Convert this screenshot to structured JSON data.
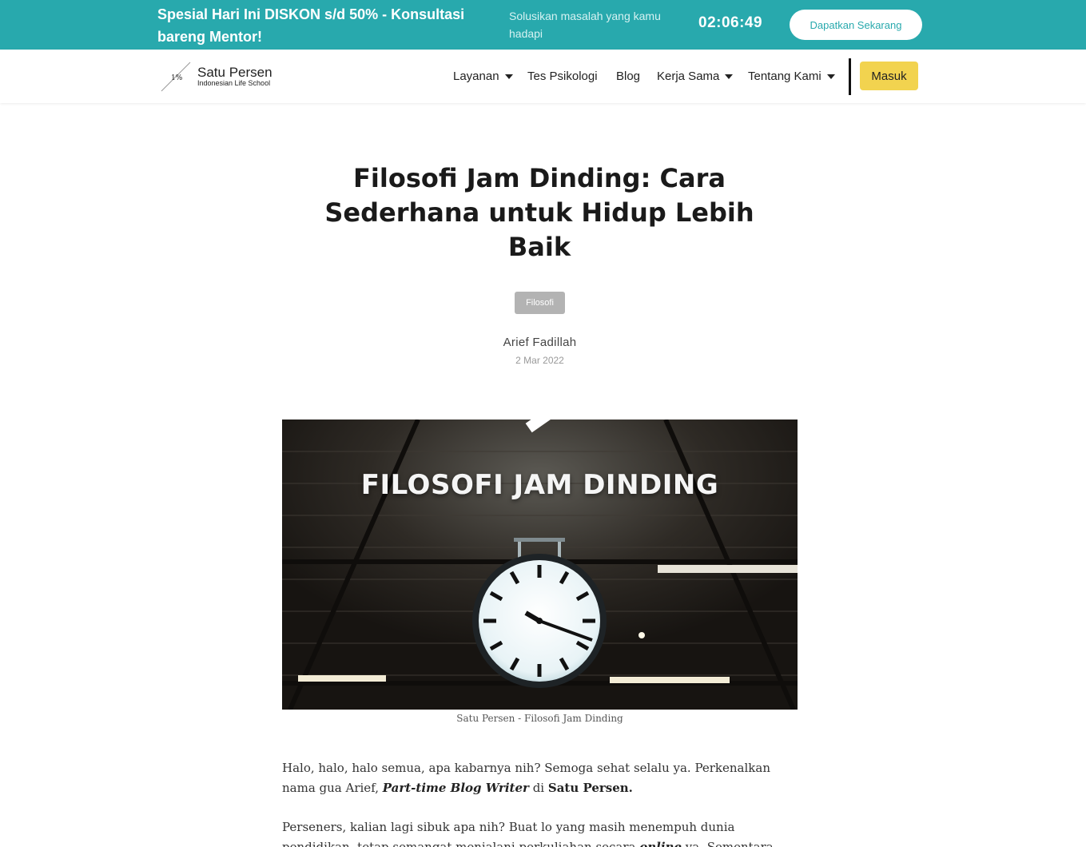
{
  "promo": {
    "title": "Spesial Hari Ini DISKON s/d 50% - Konsultasi bareng Mentor!",
    "subtitle": "Solusikan masalah yang kamu hadapi",
    "timer": "02:06:49",
    "cta": "Dapatkan Sekarang"
  },
  "header": {
    "logo_mark": "1%",
    "logo_name": "Satu Persen",
    "logo_tagline": "Indonesian Life School",
    "nav": [
      {
        "label": "Layanan",
        "dropdown": true
      },
      {
        "label": "Tes Psikologi",
        "dropdown": false
      },
      {
        "label": "Blog",
        "dropdown": false
      },
      {
        "label": "Kerja Sama",
        "dropdown": true
      },
      {
        "label": "Tentang Kami",
        "dropdown": true
      }
    ],
    "login": "Masuk"
  },
  "article": {
    "title": "Filosofi Jam Dinding: Cara Sederhana untuk Hidup Lebih Baik",
    "category": "Filosofi",
    "author": "Arief Fadillah",
    "date": "2 Mar 2022",
    "hero_text": "FILOSOFI JAM DINDING",
    "caption": "Satu Persen - Filosofi Jam Dinding",
    "p1_a": "Halo, halo, halo semua, apa kabarnya nih? Semoga sehat selalu ya. Perkenalkan nama gua Arief, ",
    "p1_em": "Part-time Blog Writer",
    "p1_b": " di ",
    "p1_strong": "Satu Persen.",
    "p2_a": "Perseners, kalian lagi sibuk apa nih? Buat lo yang masih menempuh dunia pendidikan, tetap semangat menjalani perkuliahan secara ",
    "p2_em": "online",
    "p2_b": " ya. Sementara, kalo lo udah kerja,"
  },
  "colors": {
    "promo_bg": "#28a9ad",
    "login_bg": "#f2d34f",
    "tag_bg": "#b3b3b3"
  }
}
